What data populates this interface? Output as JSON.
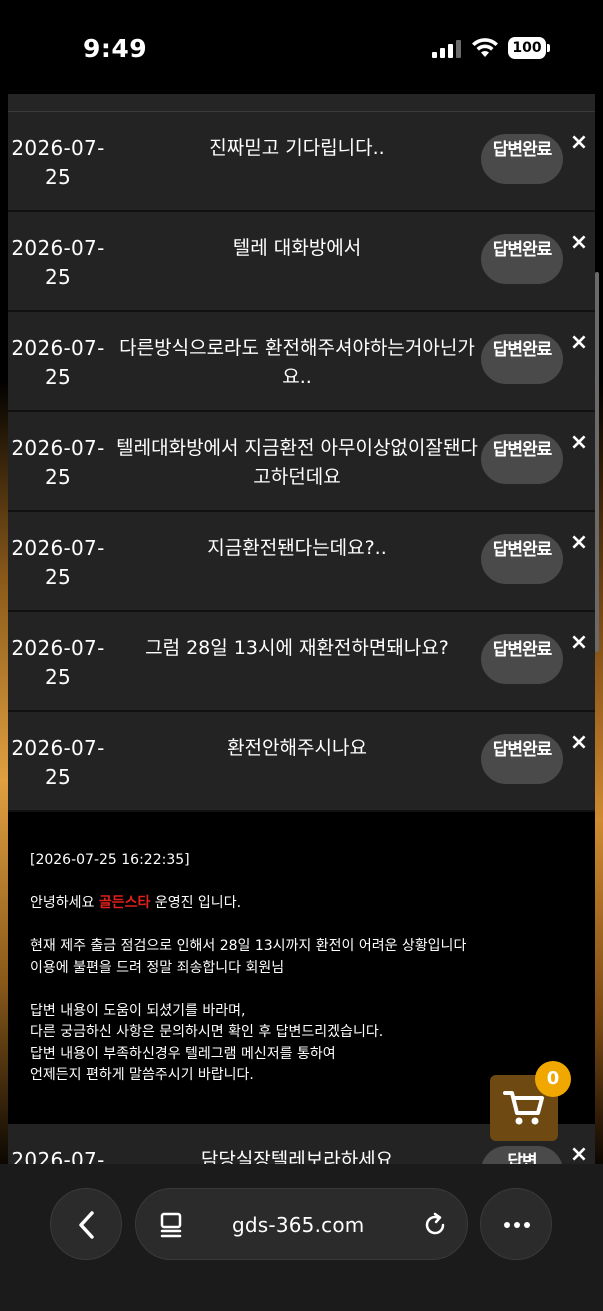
{
  "status_bar": {
    "time": "9:49",
    "battery": "100"
  },
  "rows": [
    {
      "date": "2026-07-25",
      "subject": "진짜믿고 기다립니다..",
      "status": "답변완료"
    },
    {
      "date": "2026-07-25",
      "subject": "텔레 대화방에서",
      "status": "답변완료"
    },
    {
      "date": "2026-07-25",
      "subject": "다른방식으로라도 환전해주셔야하는거아닌가요..",
      "status": "답변완료"
    },
    {
      "date": "2026-07-25",
      "subject": "텔레대화방에서 지금환전 아무이상없이잘됀다고하던데요",
      "status": "답변완료"
    },
    {
      "date": "2026-07-25",
      "subject": "지금환전됀다는데요?..",
      "status": "답변완료"
    },
    {
      "date": "2026-07-25",
      "subject": "그럼 28일 13시에 재환전하면돼나요?",
      "status": "답변완료"
    },
    {
      "date": "2026-07-25",
      "subject": "환전안해주시나요",
      "status": "답변완료"
    },
    {
      "date": "2026-07-",
      "subject": "담당실장텔레보라하세요",
      "status": "답변"
    }
  ],
  "answer": {
    "timestamp": "[2026-07-25 16:22:35]",
    "greeting_pre": "안녕하세요 ",
    "brand": "골든스타",
    "greeting_post": " 운영진 입니다.",
    "line1": "현재 제주 출금 점검으로 인해서 28일 13시까지 환전이 어려운 상황입니다",
    "line2": "이용에 불편을 드려 정말 죄송합니다 회원님",
    "line3": "답변 내용이 도움이 되셨기를 바라며,",
    "line4": "다른 궁금하신 사항은 문의하시면 확인 후 답변드리겠습니다.",
    "line5": "답변 내용이 부족하신경우 텔레그램 메신저를 통하여",
    "line6": "언제든지 편하게 말씀주시기 바랍니다."
  },
  "close_glyph": "×",
  "cart": {
    "count": "0"
  },
  "browser": {
    "url": "gds-365.com"
  },
  "colors": {
    "brand_red": "#e0201a",
    "cart_bg": "#6e4a12",
    "cart_badge": "#f0a800"
  }
}
